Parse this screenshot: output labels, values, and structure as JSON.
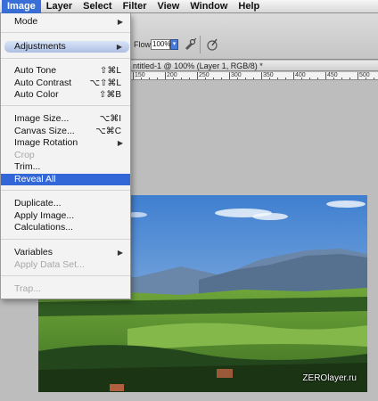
{
  "menubar": {
    "items": [
      "Image",
      "Layer",
      "Select",
      "Filter",
      "View",
      "Window",
      "Help"
    ]
  },
  "options": {
    "flow_label": "Flow:",
    "flow_value": "100%"
  },
  "document": {
    "title": "ntitled-1 @ 100% (Layer 1, RGB/8) *",
    "ruler_labels": [
      "150",
      "200",
      "250",
      "300",
      "350",
      "400",
      "450",
      "500"
    ]
  },
  "image_menu": {
    "mode": "Mode",
    "adjustments": "Adjustments",
    "auto_tone": "Auto Tone",
    "auto_tone_sc": "⇧⌘L",
    "auto_contrast": "Auto Contrast",
    "auto_contrast_sc": "⌥⇧⌘L",
    "auto_color": "Auto Color",
    "auto_color_sc": "⇧⌘B",
    "image_size": "Image Size...",
    "image_size_sc": "⌥⌘I",
    "canvas_size": "Canvas Size...",
    "canvas_size_sc": "⌥⌘C",
    "image_rotation": "Image Rotation",
    "crop": "Crop",
    "trim": "Trim...",
    "reveal_all": "Reveal All",
    "duplicate": "Duplicate...",
    "apply_image": "Apply Image...",
    "calculations": "Calculations...",
    "variables": "Variables",
    "apply_data_set": "Apply Data Set...",
    "trap": "Trap..."
  },
  "watermark": "ZEROlayer.ru",
  "colors": {
    "highlight": "#3366d6",
    "menu_bg": "#f3f3f3"
  }
}
